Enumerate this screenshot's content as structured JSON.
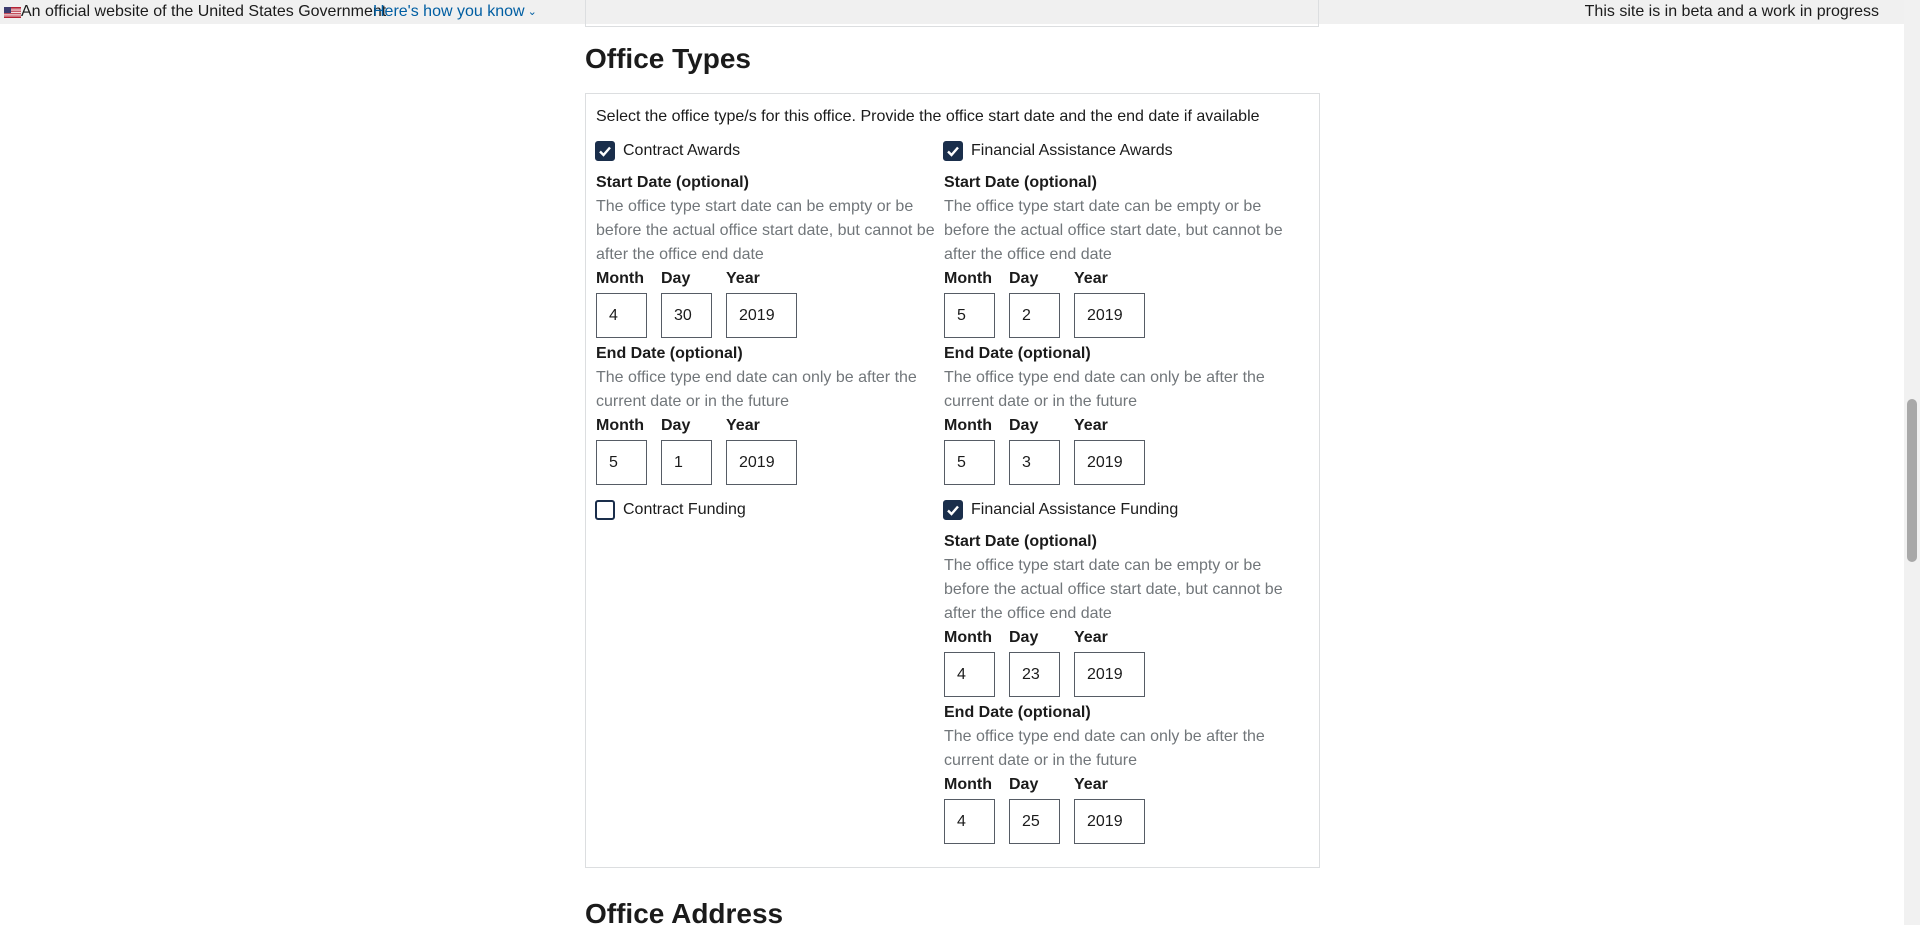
{
  "banner": {
    "official_text": "An official website of the United States Government",
    "how_link": "Here's how you know",
    "beta_text": "This site is in beta and a work in progress"
  },
  "section": {
    "title": "Office Types",
    "next_title": "Office Address",
    "instructions": "Select the office type/s for this office. Provide the office start date and the end date if available"
  },
  "labels": {
    "start_date": "Start Date (optional)",
    "end_date": "End Date (optional)",
    "start_hint": "The office type start date can be empty or be before the actual office start date, but cannot be after the office end date",
    "end_hint": "The office type end date can only be after the current date or in the future",
    "month": "Month",
    "day": "Day",
    "year": "Year"
  },
  "types": {
    "contract_awards": {
      "label": "Contract Awards",
      "checked": true,
      "start": {
        "month": "4",
        "day": "30",
        "year": "2019"
      },
      "end": {
        "month": "5",
        "day": "1",
        "year": "2019"
      }
    },
    "fin_awards": {
      "label": "Financial Assistance Awards",
      "checked": true,
      "start": {
        "month": "5",
        "day": "2",
        "year": "2019"
      },
      "end": {
        "month": "5",
        "day": "3",
        "year": "2019"
      }
    },
    "contract_funding": {
      "label": "Contract Funding",
      "checked": false
    },
    "fin_funding": {
      "label": "Financial Assistance Funding",
      "checked": true,
      "start": {
        "month": "4",
        "day": "23",
        "year": "2019"
      },
      "end": {
        "month": "4",
        "day": "25",
        "year": "2019"
      }
    }
  },
  "colors": {
    "checkbox": "#1a2e4b",
    "link": "#005ea2",
    "hint": "#71767a",
    "banner_bg": "#f0f0f0"
  }
}
